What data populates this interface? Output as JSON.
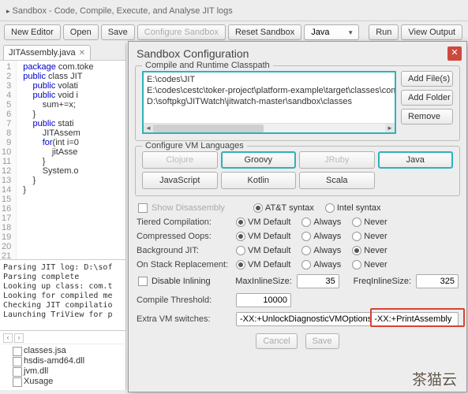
{
  "window": {
    "title": "Sandbox - Code, Compile, Execute, and Analyse JIT logs"
  },
  "toolbar": {
    "new_editor": "New Editor",
    "open": "Open",
    "save": "Save",
    "configure": "Configure Sandbox",
    "reset": "Reset Sandbox",
    "lang_selected": "Java",
    "run": "Run",
    "view_output": "View Output"
  },
  "tabs": {
    "active": "JITAssembly.java"
  },
  "code": {
    "lines": [
      "1",
      "2",
      "3",
      "4",
      "5",
      "6",
      "7",
      "8",
      "9",
      "10",
      "11",
      "12",
      "13",
      "14",
      "15",
      "16",
      "17",
      "18",
      "19",
      "20",
      "21"
    ],
    "text": "package com.toke\n\n\n\n\npublic class JIT\n    public volati\n    public void i\n        sum+=x;\n    }\n\n    public stati\n        JITAssem\n        for(int i=0\n            jitAsse\n        }\n\n        System.o\n    }\n}\n"
  },
  "log": "Parsing JIT log: D:\\sof\nParsing complete\nLooking up class: com.t\nLooking for compiled me\nChecking JIT compilatio\nLaunching TriView for p",
  "filetree": {
    "items": [
      "classes.jsa",
      "hsdis-amd64.dll",
      "jvm.dll",
      "Xusage"
    ]
  },
  "dialog": {
    "title": "Sandbox Configuration",
    "section_classpath": "Compile and Runtime Classpath",
    "classpath_items": [
      "E:\\codes\\JIT",
      "E:\\codes\\cestc\\toker-project\\platform-example\\target\\classes\\com\\ttoker\\cloud\\concurren",
      "D:\\softpkg\\JITWatch\\jitwatch-master\\sandbox\\classes"
    ],
    "add_files": "Add File(s)",
    "add_folder": "Add Folder",
    "remove": "Remove",
    "section_langs": "Configure VM Languages",
    "langs": [
      "Clojure",
      "Groovy",
      "JRuby",
      "Java",
      "JavaScript",
      "Kotlin",
      "Scala"
    ],
    "show_disassembly": "Show Disassembly",
    "syntax_att": "AT&T syntax",
    "syntax_intel": "Intel syntax",
    "tiered": "Tiered Compilation:",
    "compressed": "Compressed Oops:",
    "background_jit": "Background JIT:",
    "osr": "On Stack Replacement:",
    "vm_default": "VM Default",
    "always": "Always",
    "never": "Never",
    "disable_inlining": "Disable Inlining",
    "max_inline": "MaxInlineSize:",
    "max_inline_val": "35",
    "freq_inline": "FreqInlineSize:",
    "freq_inline_val": "325",
    "compile_threshold": "Compile Threshold:",
    "compile_threshold_val": "10000",
    "extra_vm": "Extra VM switches:",
    "extra_vm_val": "-XX:+UnlockDiagnosticVMOptions -XX:+PrintAssembly",
    "cancel": "Cancel",
    "save": "Save"
  },
  "watermark": "茶猫云"
}
